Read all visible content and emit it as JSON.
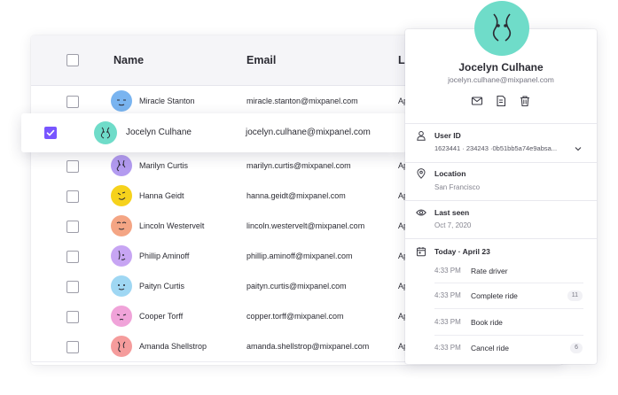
{
  "table": {
    "headers": {
      "name": "Name",
      "email": "Email",
      "last": "La"
    },
    "rows": [
      {
        "name": "Miracle Stanton",
        "email": "miracle.stanton@mixpanel.com",
        "last": "Ap",
        "avatar_color": "#79b4f0"
      },
      {
        "name": "Marilyn Curtis",
        "email": "marilyn.curtis@mixpanel.com",
        "last": "Ap",
        "avatar_color": "#b39bf0"
      },
      {
        "name": "Hanna Geidt",
        "email": "hanna.geidt@mixpanel.com",
        "last": "Ap",
        "avatar_color": "#f6d21c"
      },
      {
        "name": "Lincoln Westervelt",
        "email": "lincoln.westervelt@mixpanel.com",
        "last": "Ap",
        "avatar_color": "#f4a584"
      },
      {
        "name": "Phillip Aminoff",
        "email": "phillip.aminoff@mixpanel.com",
        "last": "Ap",
        "avatar_color": "#c7a5f3"
      },
      {
        "name": "Paityn Curtis",
        "email": "paityn.curtis@mixpanel.com",
        "last": "Ap",
        "avatar_color": "#9fd7f3"
      },
      {
        "name": "Cooper Torff",
        "email": "copper.torff@mixpanel.com",
        "last": "Ap",
        "avatar_color": "#f0a3d9"
      },
      {
        "name": "Amanda Shellstrop",
        "email": "amanda.shellstrop@mixpanel.com",
        "last": "Ap",
        "avatar_color": "#f59c9c"
      }
    ]
  },
  "selected": {
    "name": "Jocelyn Culhane",
    "email": "jocelyn.culhane@mixpanel.com",
    "checkbox_color": "#7856ff",
    "avatar_color": "#6fdcc9"
  },
  "profile": {
    "name": "Jocelyn Culhane",
    "email": "jocelyn.culhane@mixpanel.com",
    "avatar_color": "#6fdcc9",
    "actions": [
      "mail-icon",
      "note-icon",
      "trash-icon"
    ],
    "user_id": {
      "label": "User ID",
      "value": "1623441 · 234243 ·0b51bb5a74e9absa..."
    },
    "location": {
      "label": "Location",
      "value": "San Francisco"
    },
    "last_seen": {
      "label": "Last seen",
      "value": "Oct 7, 2020"
    },
    "activity": {
      "heading": "Today · April 23",
      "events": [
        {
          "time": "4:33 PM",
          "name": "Rate driver",
          "count": ""
        },
        {
          "time": "4:33 PM",
          "name": "Complete ride",
          "count": "11"
        },
        {
          "time": "4:33 PM",
          "name": "Book ride",
          "count": ""
        },
        {
          "time": "4:33 PM",
          "name": "Cancel ride",
          "count": "6"
        }
      ]
    }
  }
}
